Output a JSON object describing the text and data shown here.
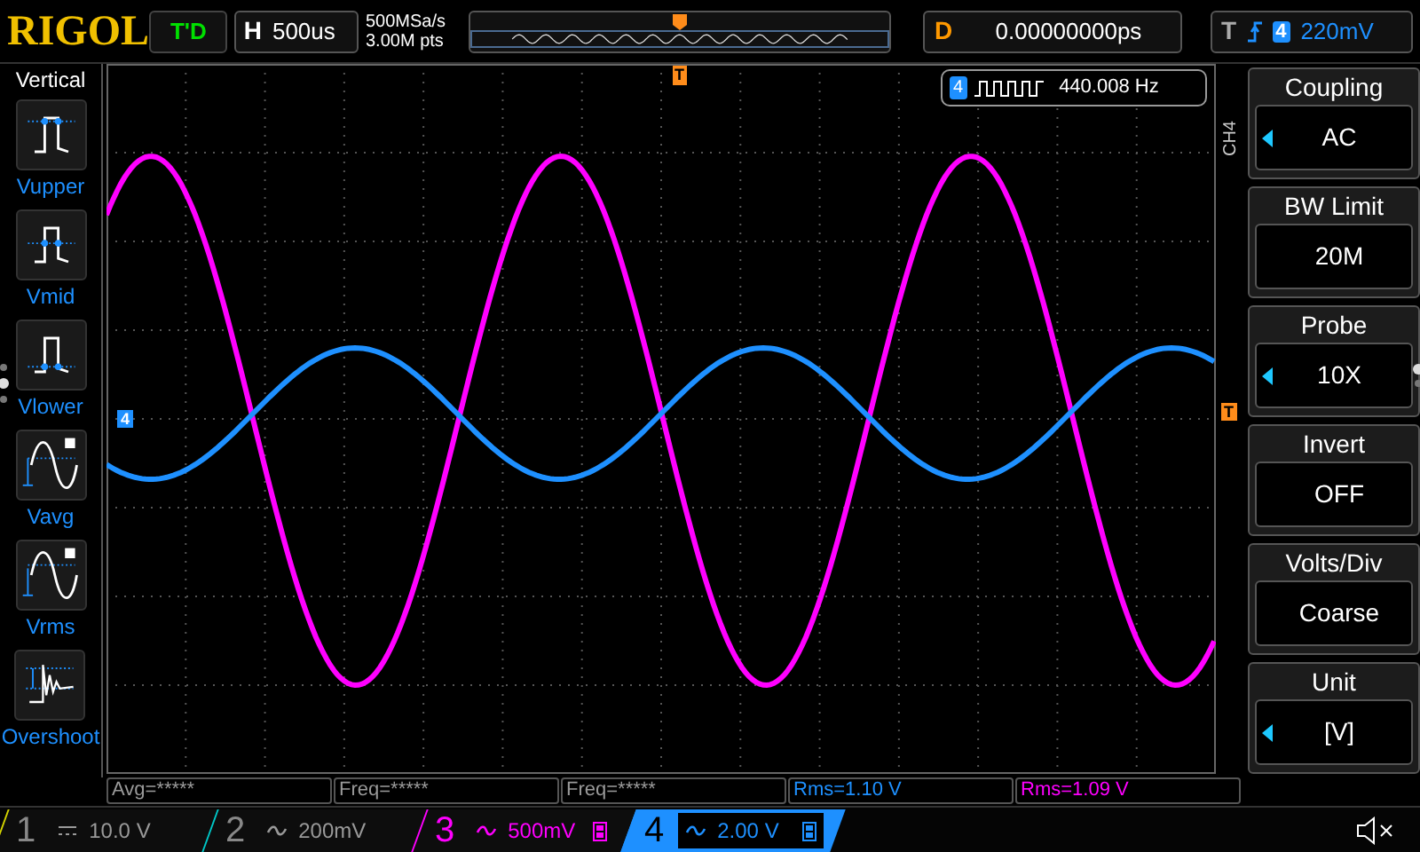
{
  "header": {
    "logo": "RIGOL",
    "run_status": "T'D",
    "horizontal": {
      "label": "H",
      "value": "500us"
    },
    "sample_rate": "500MSa/s",
    "memory_depth": "3.00M pts",
    "delay": {
      "label": "D",
      "value": "0.00000000ps"
    },
    "trigger": {
      "label": "T",
      "source": "4",
      "level": "220mV"
    }
  },
  "left_menu": {
    "title": "Vertical",
    "items": [
      {
        "label": "Vupper",
        "kind": "vupper"
      },
      {
        "label": "Vmid",
        "kind": "vmid"
      },
      {
        "label": "Vlower",
        "kind": "vlower"
      },
      {
        "label": "Vavg",
        "kind": "vavg"
      },
      {
        "label": "Vrms",
        "kind": "vrms"
      },
      {
        "label": "Overshoot",
        "kind": "overshoot"
      }
    ]
  },
  "display": {
    "channel_marker": "4",
    "trigger_marker": "T",
    "trigger_position": "T",
    "counter": {
      "channel": "4",
      "value": "440.008 Hz"
    }
  },
  "right_menu": {
    "channel": "CH4",
    "items": [
      {
        "title": "Coupling",
        "value": "AC",
        "arrow": true
      },
      {
        "title": "BW Limit",
        "value": "20M",
        "arrow": false
      },
      {
        "title": "Probe",
        "value": "10X",
        "arrow": true
      },
      {
        "title": "Invert",
        "value": "OFF",
        "arrow": false
      },
      {
        "title": "Volts/Div",
        "value": "Coarse",
        "arrow": false
      },
      {
        "title": "Unit",
        "value": "[V]",
        "arrow": true
      }
    ]
  },
  "measurements": [
    {
      "text": "Avg=*****",
      "color": "#9a9a9a"
    },
    {
      "text": "Freq=*****",
      "color": "#9a9a9a"
    },
    {
      "text": "Freq=*****",
      "color": "#9a9a9a"
    },
    {
      "text": "Rms=1.10 V",
      "color": "#1e90ff"
    },
    {
      "text": "Rms=1.09 V",
      "color": "#ff00ff"
    }
  ],
  "channels": [
    {
      "number": "1",
      "kind": "dc",
      "scale": "10.0 V",
      "on": false,
      "selected": false,
      "color": "#d4d400",
      "bw_limit": false
    },
    {
      "number": "2",
      "kind": "ac",
      "scale": "200mV",
      "on": false,
      "selected": false,
      "color": "#00c8c8",
      "bw_limit": false
    },
    {
      "number": "3",
      "kind": "ac",
      "scale": "500mV",
      "on": true,
      "selected": false,
      "color": "#ff00ff",
      "bw_limit": true
    },
    {
      "number": "4",
      "kind": "ac",
      "scale": "2.00 V",
      "on": true,
      "selected": true,
      "color": "#1e90ff",
      "bw_limit": true
    }
  ]
}
